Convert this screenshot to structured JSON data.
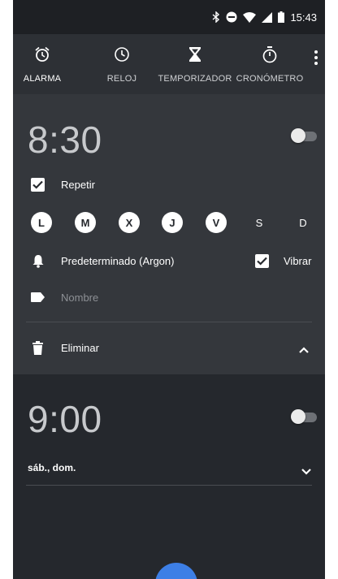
{
  "status_bar": {
    "time": "15:43"
  },
  "tabs": [
    {
      "label": "ALARMA",
      "icon": "alarm-icon",
      "active": true
    },
    {
      "label": "RELOJ",
      "icon": "clock-icon",
      "active": false
    },
    {
      "label": "TEMPORIZADOR",
      "icon": "hourglass-icon",
      "active": false
    },
    {
      "label": "CRONÓMETRO",
      "icon": "stopwatch-icon",
      "active": false
    }
  ],
  "alarm1": {
    "time": "8:30",
    "enabled": false,
    "repeat_label": "Repetir",
    "repeat_checked": true,
    "days": [
      {
        "label": "L",
        "selected": true
      },
      {
        "label": "M",
        "selected": true
      },
      {
        "label": "X",
        "selected": true
      },
      {
        "label": "J",
        "selected": true
      },
      {
        "label": "V",
        "selected": true
      },
      {
        "label": "S",
        "selected": false
      },
      {
        "label": "D",
        "selected": false
      }
    ],
    "ringtone": "Predeterminado (Argon)",
    "vibrate_label": "Vibrar",
    "vibrate_checked": true,
    "name_placeholder": "Nombre",
    "delete_label": "Eliminar"
  },
  "alarm2": {
    "time": "9:00",
    "enabled": false,
    "days_summary": "sáb., dom."
  },
  "colors": {
    "background": "#25282d",
    "expanded_card": "#34373c",
    "fab": "#3d7fe6"
  }
}
